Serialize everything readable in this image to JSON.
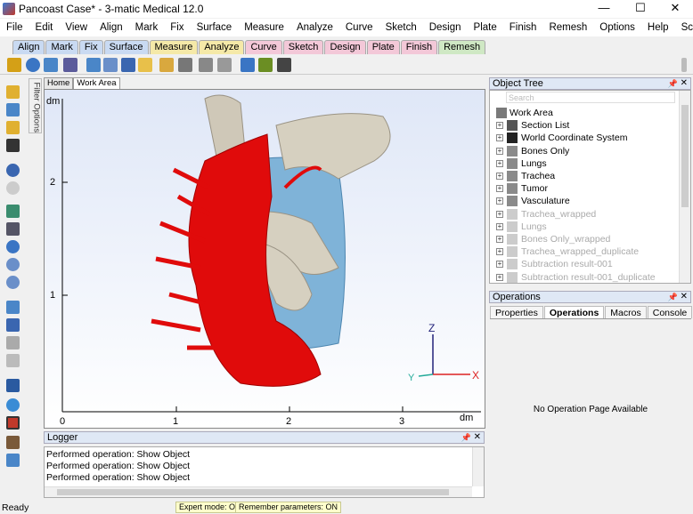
{
  "window": {
    "title": "Pancoast Case* - 3-matic Medical 12.0",
    "controls": {
      "minimize": "—",
      "maximize": "☐",
      "close": "✕"
    }
  },
  "menu": [
    "File",
    "Edit",
    "View",
    "Align",
    "Mark",
    "Fix",
    "Surface",
    "Measure",
    "Analyze",
    "Curve",
    "Sketch",
    "Design",
    "Plate",
    "Finish",
    "Remesh",
    "Options",
    "Help",
    "Script"
  ],
  "ribbon_tabs": [
    {
      "label": "Align",
      "color": "#c9daf2"
    },
    {
      "label": "Mark",
      "color": "#c9daf2"
    },
    {
      "label": "Fix",
      "color": "#c9daf2"
    },
    {
      "label": "Surface",
      "color": "#c9daf2"
    },
    {
      "label": "Measure",
      "color": "#f5e9a8"
    },
    {
      "label": "Analyze",
      "color": "#f5e9a8"
    },
    {
      "label": "Curve",
      "color": "#f3c8d8"
    },
    {
      "label": "Sketch",
      "color": "#f3c8d8"
    },
    {
      "label": "Design",
      "color": "#f3c8d8"
    },
    {
      "label": "Plate",
      "color": "#f3c8d8"
    },
    {
      "label": "Finish",
      "color": "#f3c8d8"
    },
    {
      "label": "Remesh",
      "color": "#cfe8c4"
    }
  ],
  "filter_options_label": "Filter Options",
  "view_tabs": [
    "Home",
    "Work Area"
  ],
  "viewport": {
    "unit_label": "dm",
    "y_ticks": [
      "2",
      "1"
    ],
    "x_ticks": [
      "0",
      "1",
      "2",
      "3"
    ],
    "axis_labels": {
      "x": "X",
      "y": "Y",
      "z": "Z"
    }
  },
  "object_tree": {
    "header": "Object Tree",
    "search_placeholder": "Search",
    "items": [
      {
        "label": "Work Area",
        "dim": false,
        "icon": "work-area"
      },
      {
        "label": "Section List",
        "dim": false,
        "icon": "section-list"
      },
      {
        "label": "World Coordinate System",
        "dim": false,
        "icon": "coordinate-system"
      },
      {
        "label": "Bones Only",
        "dim": false,
        "icon": "part"
      },
      {
        "label": "Lungs",
        "dim": false,
        "icon": "part"
      },
      {
        "label": "Trachea",
        "dim": false,
        "icon": "part"
      },
      {
        "label": "Tumor",
        "dim": false,
        "icon": "part"
      },
      {
        "label": "Vasculature",
        "dim": false,
        "icon": "part"
      },
      {
        "label": "Trachea_wrapped",
        "dim": true,
        "icon": "part"
      },
      {
        "label": "Lungs",
        "dim": true,
        "icon": "part"
      },
      {
        "label": "Bones Only_wrapped",
        "dim": true,
        "icon": "part"
      },
      {
        "label": "Trachea_wrapped_duplicate",
        "dim": true,
        "icon": "part"
      },
      {
        "label": "Subtraction result-001",
        "dim": true,
        "icon": "part"
      },
      {
        "label": "Subtraction result-001_duplicate",
        "dim": true,
        "icon": "part"
      }
    ]
  },
  "operations": {
    "header": "Operations",
    "tabs": [
      "Properties",
      "Operations",
      "Macros",
      "Console"
    ],
    "active_tab": "Operations",
    "message": "No Operation Page Available"
  },
  "logger": {
    "header": "Logger",
    "lines": [
      "Performed operation: Show Object",
      "Performed operation: Show Object",
      "Performed operation: Show Object"
    ]
  },
  "status": {
    "ready": "Ready",
    "expert_mode": "Expert mode: ON",
    "remember_params": "Remember parameters: ON"
  }
}
